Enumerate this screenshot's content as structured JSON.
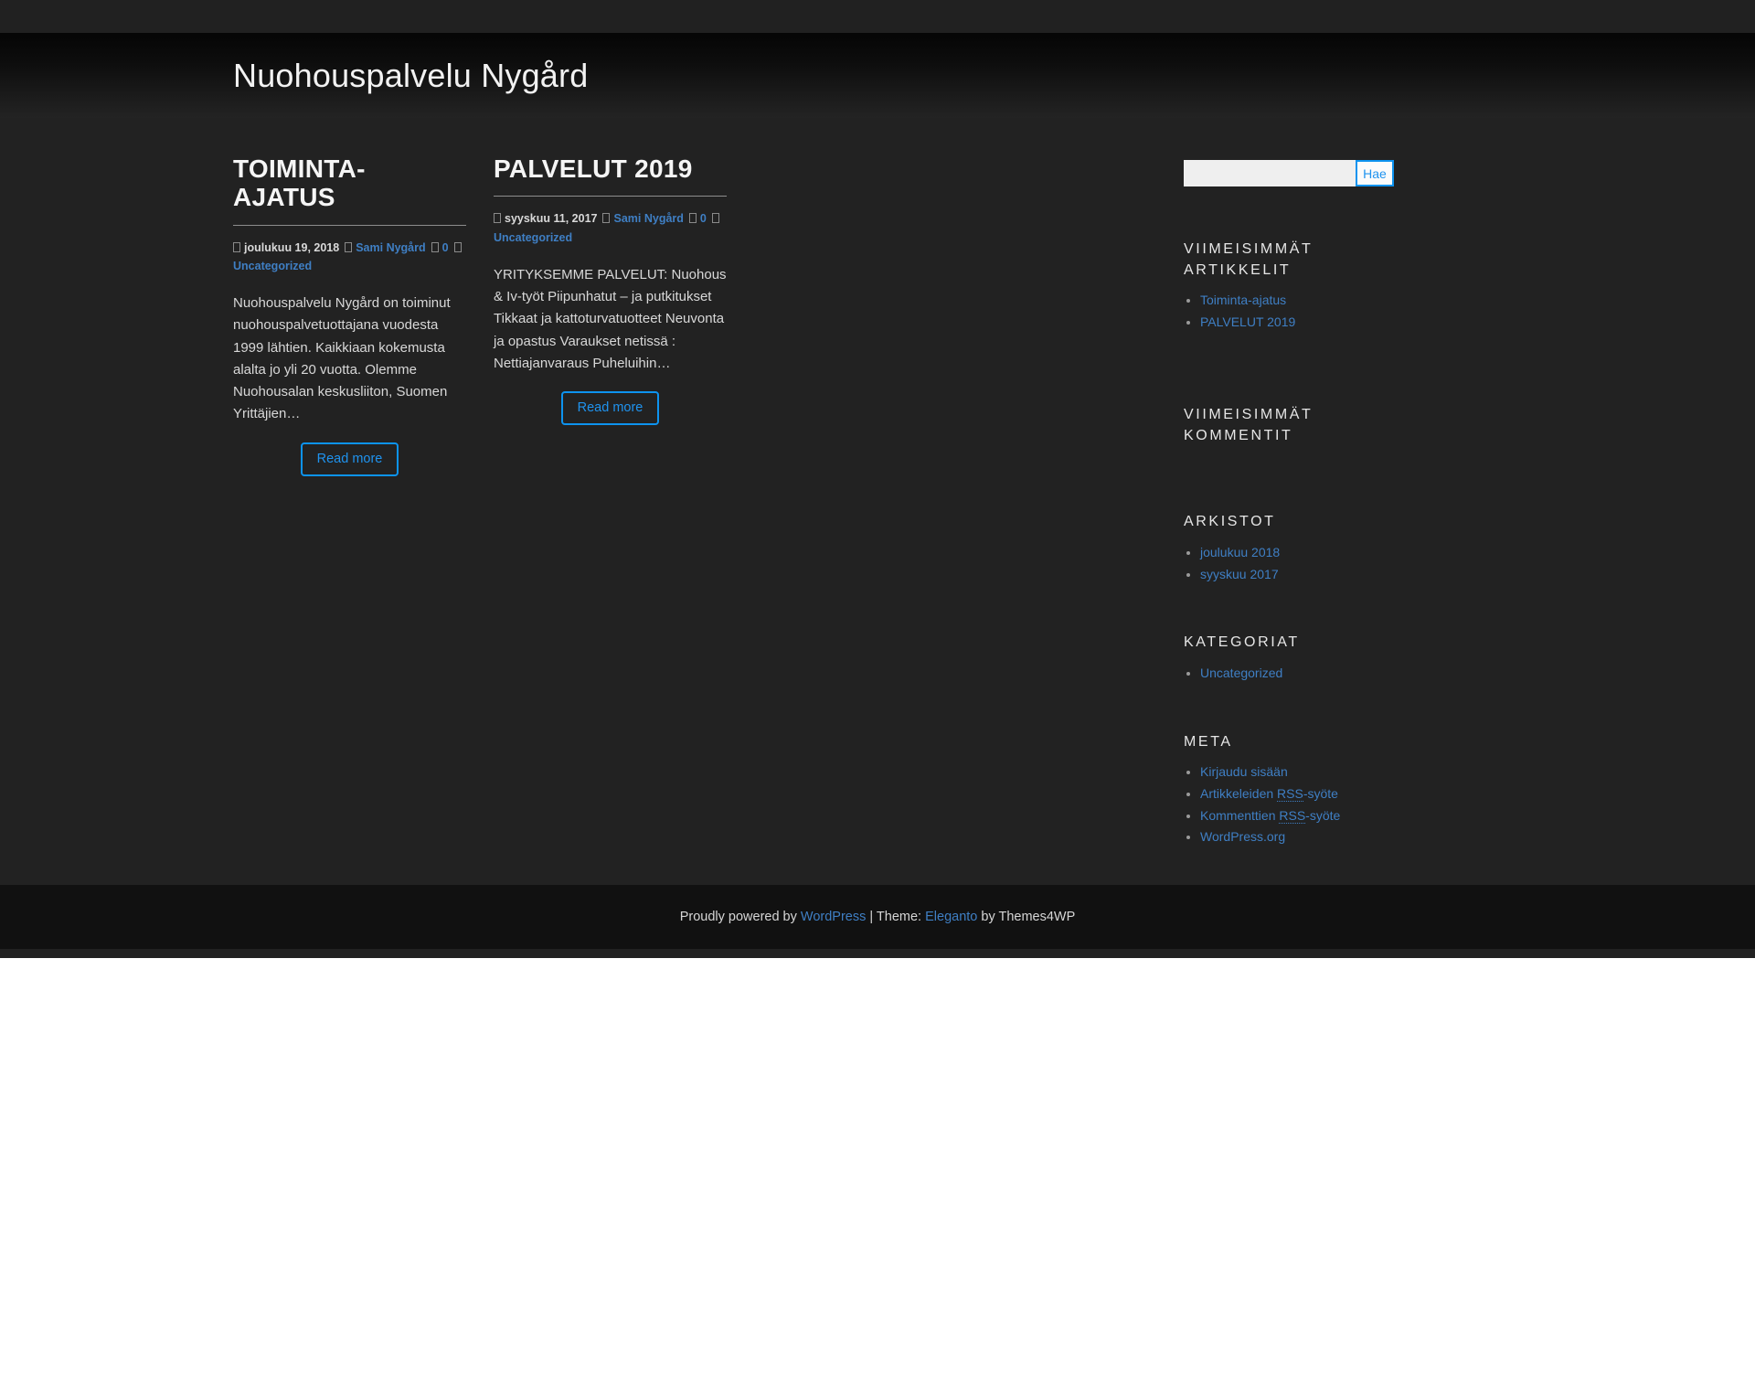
{
  "site": {
    "title": "Nuohouspalvelu Nygård"
  },
  "search": {
    "value": "",
    "placeholder": "",
    "submit_label": "Hae"
  },
  "posts": [
    {
      "title": "TOIMINTA-AJATUS",
      "date": "joulukuu 19, 2018",
      "author": "Sami Nygård",
      "comments": "0",
      "category": "Uncategorized",
      "excerpt": "Nuohouspalvelu Nygård on toiminut nuohouspalvetuottajana vuodesta 1999 lähtien. Kaikkiaan kokemusta alalta jo yli 20 vuotta. Olemme Nuohousalan keskusliiton, Suomen Yrittäjien…",
      "read_more": "Read more"
    },
    {
      "title": "PALVELUT 2019",
      "date": "syyskuu 11, 2017",
      "author": "Sami Nygård",
      "comments": "0",
      "category": "Uncategorized",
      "excerpt": "YRITYKSEMME PALVELUT: Nuohous & Iv-työt Piipunhatut – ja  putkitukset Tikkaat ja kattoturvatuotteet Neuvonta ja opastus Varaukset netissä :  Nettiajanvaraus Puheluihin…",
      "read_more": "Read more"
    }
  ],
  "sidebar": {
    "recent_posts": {
      "title": "Viimeisimmät artikkelit",
      "items": [
        {
          "label": "Toiminta-ajatus"
        },
        {
          "label": "PALVELUT 2019"
        }
      ]
    },
    "recent_comments": {
      "title": "Viimeisimmät kommentit",
      "items": []
    },
    "archives": {
      "title": "Arkistot",
      "items": [
        {
          "label": "joulukuu 2018"
        },
        {
          "label": "syyskuu 2017"
        }
      ]
    },
    "categories": {
      "title": "Kategoriat",
      "items": [
        {
          "label": "Uncategorized"
        }
      ]
    },
    "meta": {
      "title": "Meta",
      "items": [
        {
          "label": "Kirjaudu sisään",
          "pre": "",
          "abbr": "",
          "post": ""
        },
        {
          "label": "",
          "pre": "Artikkeleiden ",
          "abbr": "RSS",
          "post": "-syöte"
        },
        {
          "label": "",
          "pre": "Kommenttien ",
          "abbr": "RSS",
          "post": "-syöte"
        },
        {
          "label": "WordPress.org",
          "pre": "",
          "abbr": "",
          "post": ""
        }
      ]
    }
  },
  "footer": {
    "prefix": "Proudly powered by ",
    "wordpress": "WordPress",
    "separator": " | Theme: ",
    "theme": "Eleganto",
    "suffix": " by Themes4WP"
  },
  "colors": {
    "accent_blue": "#0d93ef",
    "link_blue": "#3f7fc4",
    "page_bg": "#222222",
    "footer_bg": "#111111"
  }
}
